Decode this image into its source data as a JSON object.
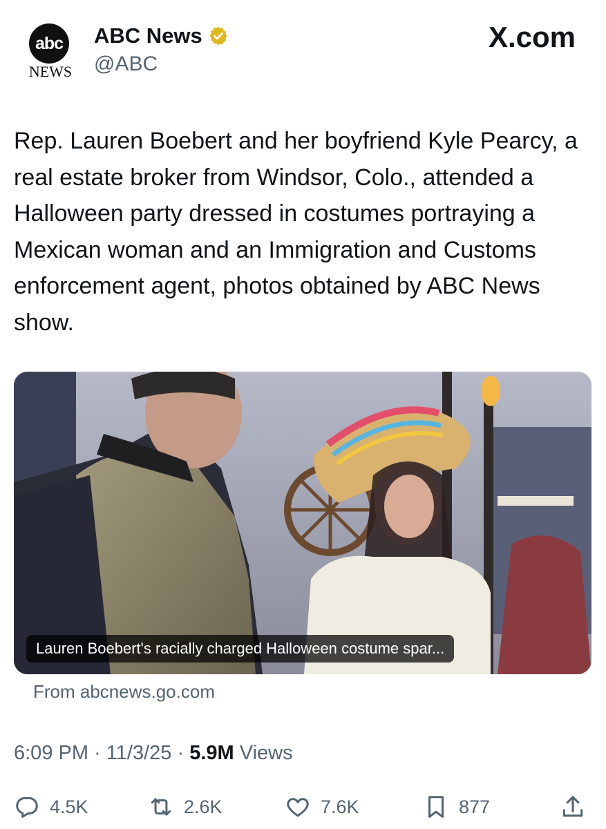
{
  "header": {
    "logo_top": "abc",
    "logo_bottom": "NEWS",
    "author_name": "ABC News",
    "handle": "@ABC",
    "brand": "X.com",
    "verified_icon": "verified-badge-gold"
  },
  "tweet": {
    "text": "Rep. Lauren Boebert and her boyfriend Kyle Pearcy, a real estate broker from Windsor, Colo., attended a Halloween party dressed in costumes portraying a Mexican woman and an Immigration and Customs enforcement agent, photos obtained by ABC News show."
  },
  "card": {
    "caption": "Lauren Boebert's racially charged Halloween costume spar...",
    "source": "From abcnews.go.com"
  },
  "meta": {
    "time": "6:09 PM",
    "separator": "·",
    "date": "11/3/25",
    "views_count": "5.9M",
    "views_label": "Views"
  },
  "actions": {
    "replies": "4.5K",
    "reposts": "2.6K",
    "likes": "7.6K",
    "bookmarks": "877"
  },
  "colors": {
    "text": "#0f1419",
    "secondary": "#536471",
    "verified": "#e2b719"
  }
}
